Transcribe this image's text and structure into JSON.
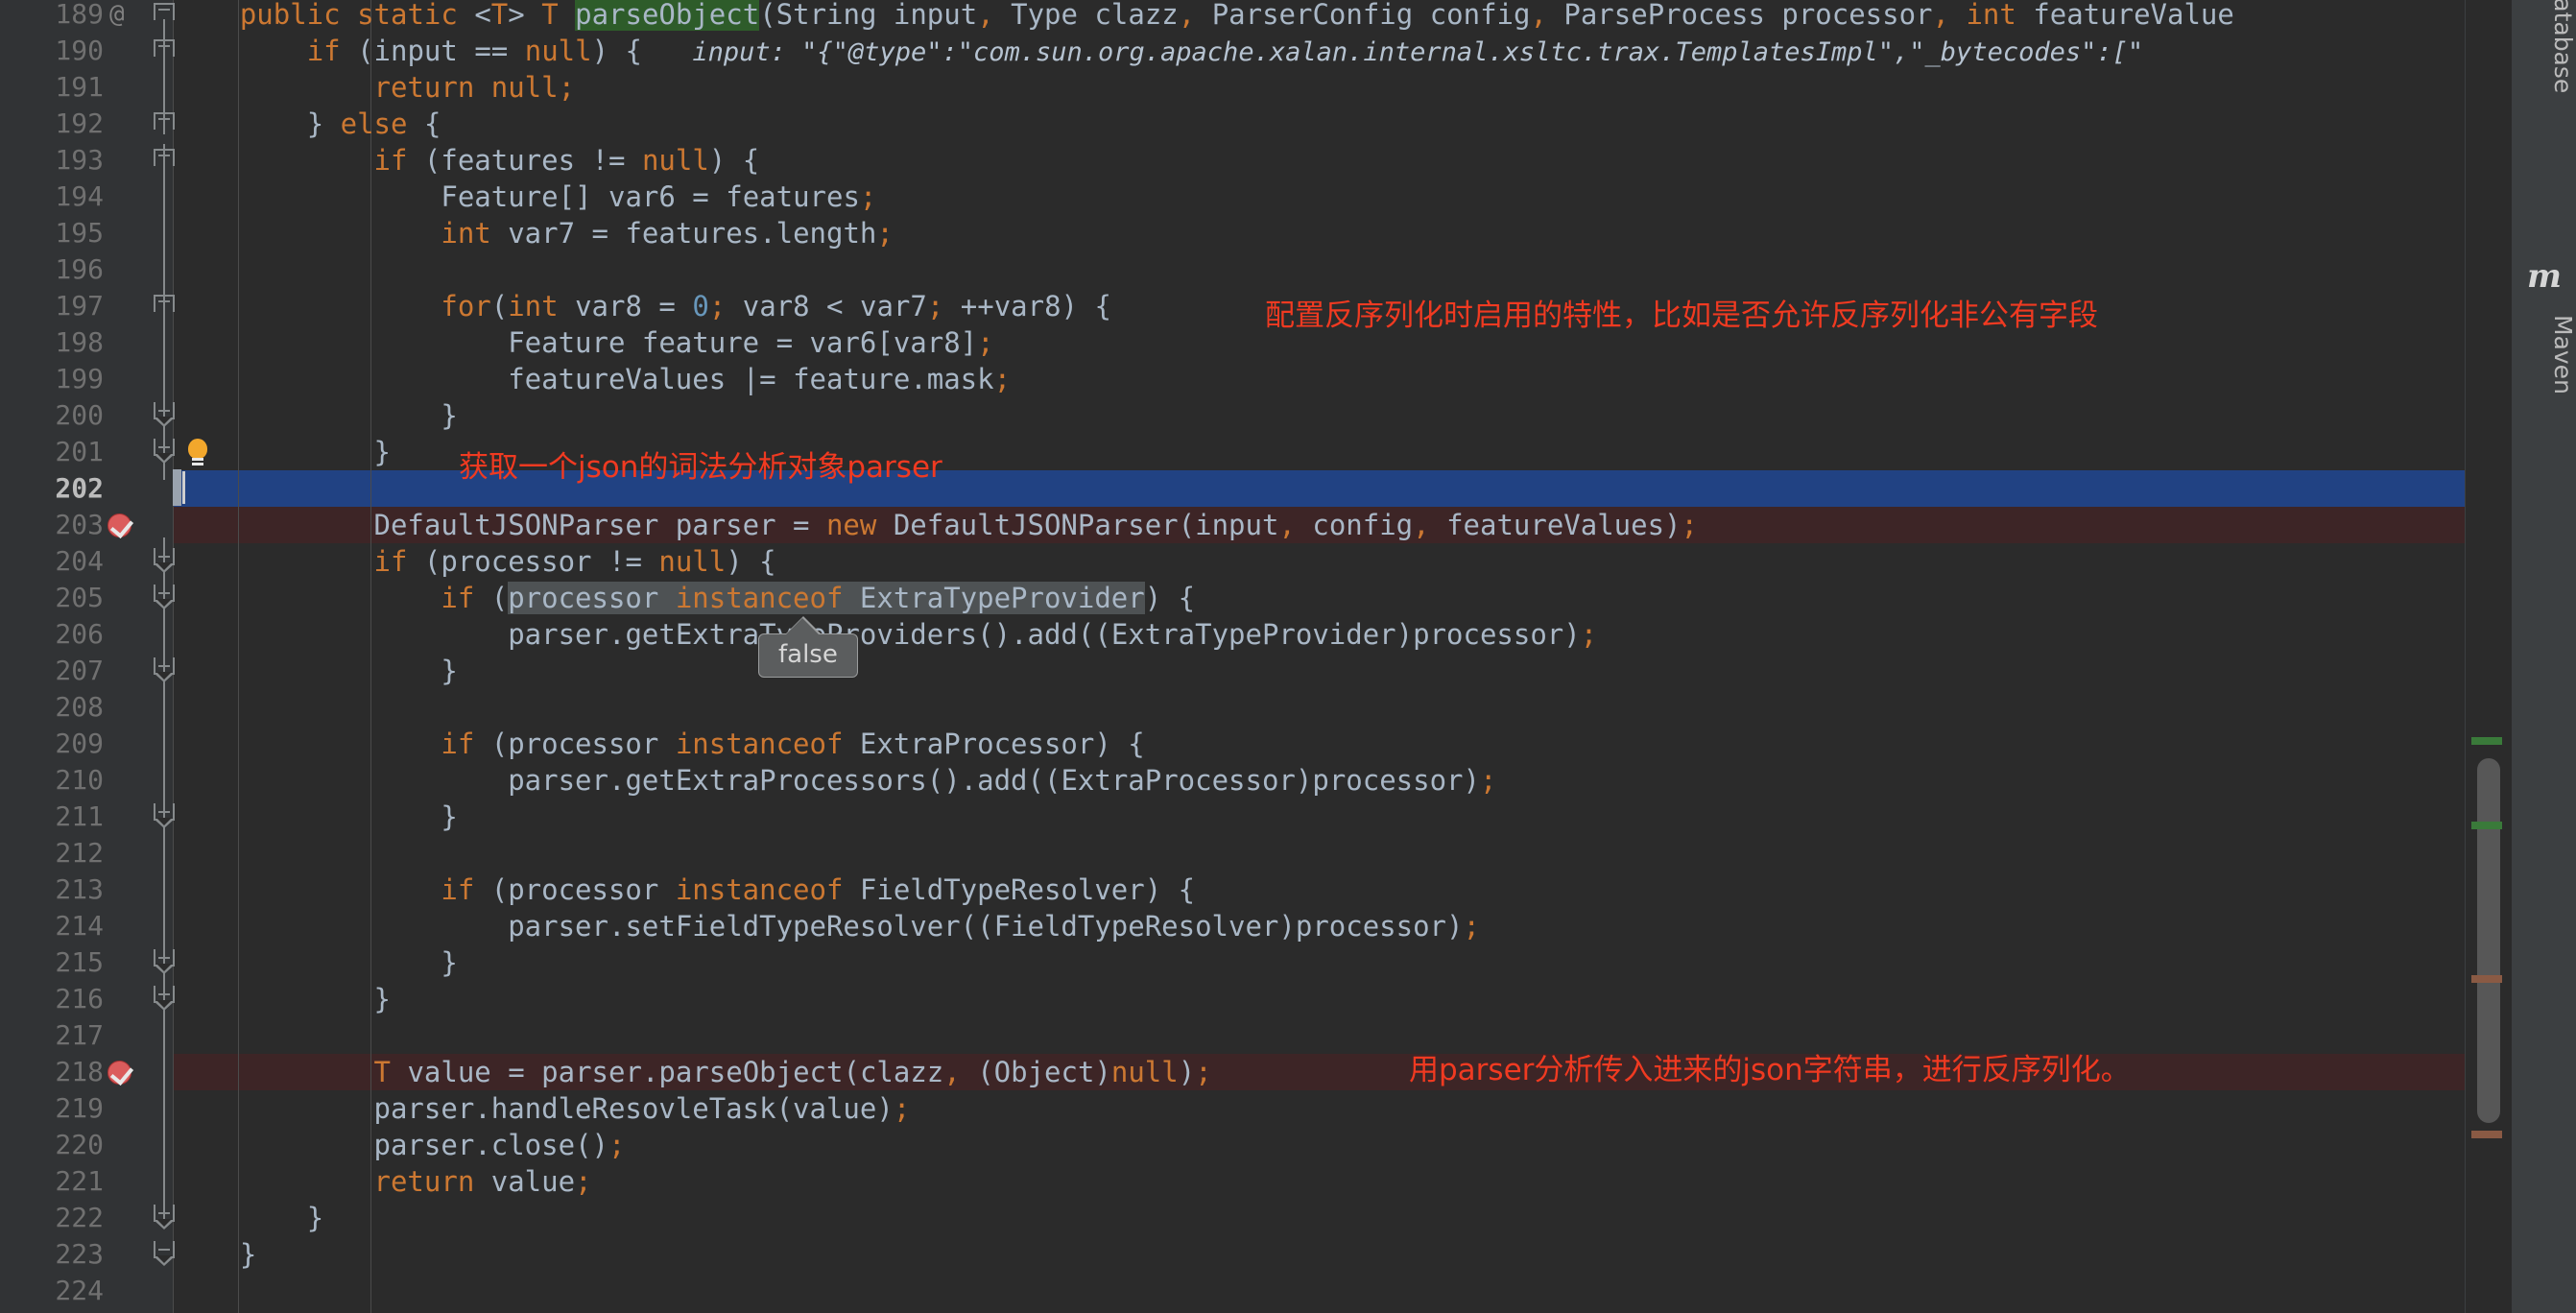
{
  "editor": {
    "theme": "darcula",
    "colors": {
      "background": "#2B2B2B",
      "gutter": "#313335",
      "keyword": "#CC7832",
      "identifier": "#A9B7C6",
      "number": "#6897BB",
      "current_line": "#214283",
      "breakpoint_line": "#3D2526",
      "search_hit": "#2E5C2A",
      "annotation_red": "#F03A21",
      "toolwindow_bar": "#3C3F41"
    },
    "first_line": 189,
    "last_line": 224,
    "current_line_number": 202,
    "lines": [
      {
        "n": 189,
        "text": "    public static <T> T parseObject(String input, Type clazz, ParserConfig config, ParseProcess processor, int featureValue"
      },
      {
        "n": 190,
        "text": "        if (input == null) {   input: \"{\"@type\":\"com.sun.org.apache.xalan.internal.xsltc.trax.TemplatesImpl\",\"_bytecodes\":[\""
      },
      {
        "n": 191,
        "text": "            return null;"
      },
      {
        "n": 192,
        "text": "        } else {"
      },
      {
        "n": 193,
        "text": "            if (features != null) {"
      },
      {
        "n": 194,
        "text": "                Feature[] var6 = features;"
      },
      {
        "n": 195,
        "text": "                int var7 = features.length;"
      },
      {
        "n": 196,
        "text": ""
      },
      {
        "n": 197,
        "text": "                for(int var8 = 0; var8 < var7; ++var8) {"
      },
      {
        "n": 198,
        "text": "                    Feature feature = var6[var8];"
      },
      {
        "n": 199,
        "text": "                    featureValues |= feature.mask;"
      },
      {
        "n": 200,
        "text": "                }"
      },
      {
        "n": 201,
        "text": "            }"
      },
      {
        "n": 202,
        "text": ""
      },
      {
        "n": 203,
        "text": "            DefaultJSONParser parser = new DefaultJSONParser(input, config, featureValues);"
      },
      {
        "n": 204,
        "text": "            if (processor != null) {"
      },
      {
        "n": 205,
        "text": "                if (processor instanceof ExtraTypeProvider) {"
      },
      {
        "n": 206,
        "text": "                    parser.getExtraTypeProviders().add((ExtraTypeProvider)processor);"
      },
      {
        "n": 207,
        "text": "                }"
      },
      {
        "n": 208,
        "text": ""
      },
      {
        "n": 209,
        "text": "                if (processor instanceof ExtraProcessor) {"
      },
      {
        "n": 210,
        "text": "                    parser.getExtraProcessors().add((ExtraProcessor)processor);"
      },
      {
        "n": 211,
        "text": "                }"
      },
      {
        "n": 212,
        "text": ""
      },
      {
        "n": 213,
        "text": "                if (processor instanceof FieldTypeResolver) {"
      },
      {
        "n": 214,
        "text": "                    parser.setFieldTypeResolver((FieldTypeResolver)processor);"
      },
      {
        "n": 215,
        "text": "                }"
      },
      {
        "n": 216,
        "text": "            }"
      },
      {
        "n": 217,
        "text": ""
      },
      {
        "n": 218,
        "text": "            T value = parser.parseObject(clazz, (Object)null);"
      },
      {
        "n": 219,
        "text": "            parser.handleResovleTask(value);"
      },
      {
        "n": 220,
        "text": "            parser.close();"
      },
      {
        "n": 221,
        "text": "            return value;"
      },
      {
        "n": 222,
        "text": "        }"
      },
      {
        "n": 223,
        "text": "    }"
      },
      {
        "n": 224,
        "text": ""
      }
    ],
    "search_highlight": "parseObject",
    "inline_hint": {
      "line": 190,
      "text": "input: \"{\"@type\":\"com.sun.org.apache.xalan.internal.xsltc.trax.TemplatesImpl\",\"_bytecodes\":[\""
    },
    "annotations": [
      {
        "line": 197,
        "text": "配置反序列化时启用的特性，比如是否允许反序列化非公有字段"
      },
      {
        "line": 201,
        "text": "获取一个json的词法分析对象parser"
      },
      {
        "line": 218,
        "text": "用parser分析传入进来的json字符串，进行反序列化。"
      }
    ],
    "breakpoints": [
      203,
      218
    ],
    "gutter_annotation_symbol": "@",
    "intention_bulb_line": 201
  },
  "tooltip": {
    "text": "false",
    "target_line": 205,
    "target_expression": "processor instanceof ExtraTypeProvider"
  },
  "toolwindows": [
    {
      "label": "Database",
      "icon": "database-icon"
    },
    {
      "label": "Maven",
      "icon": "maven-m-icon"
    }
  ],
  "scrollbar": {
    "marks": [
      {
        "color": "#3A7A3A",
        "label": "search-match-marker"
      },
      {
        "color": "#3A7A3A",
        "label": "search-match-marker"
      },
      {
        "color": "#8A5A44",
        "label": "breakpoint-marker"
      },
      {
        "color": "#8A5A44",
        "label": "breakpoint-marker"
      }
    ]
  }
}
